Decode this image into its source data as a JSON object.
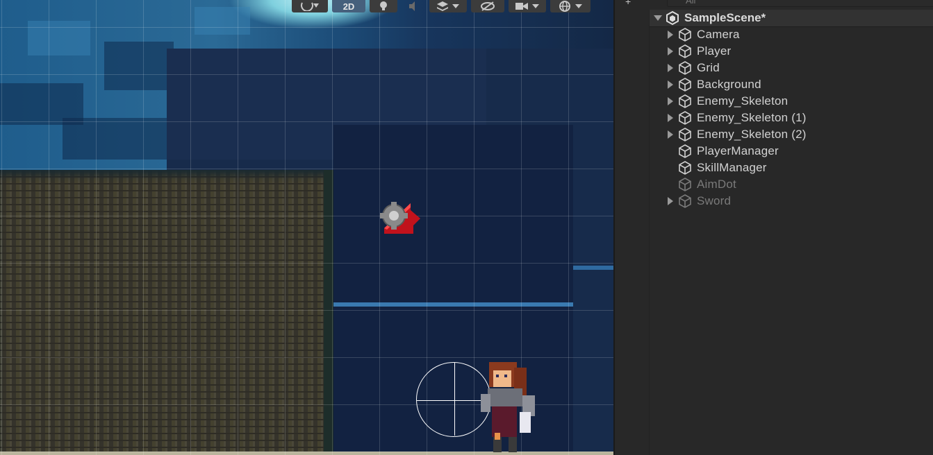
{
  "toolbar": {
    "mode_2d_label": "2D"
  },
  "hierarchy": {
    "search_placeholder": "All",
    "add_label": "+",
    "scene_name": "SampleScene*",
    "items": [
      {
        "name": "Camera",
        "expandable": true,
        "dimmed": false
      },
      {
        "name": "Player",
        "expandable": true,
        "dimmed": false
      },
      {
        "name": "Grid",
        "expandable": true,
        "dimmed": false
      },
      {
        "name": "Background",
        "expandable": true,
        "dimmed": false
      },
      {
        "name": "Enemy_Skeleton",
        "expandable": true,
        "dimmed": false
      },
      {
        "name": "Enemy_Skeleton (1)",
        "expandable": true,
        "dimmed": false
      },
      {
        "name": "Enemy_Skeleton (2)",
        "expandable": true,
        "dimmed": false
      },
      {
        "name": "PlayerManager",
        "expandable": false,
        "dimmed": false
      },
      {
        "name": "SkillManager",
        "expandable": false,
        "dimmed": false
      },
      {
        "name": "AimDot",
        "expandable": false,
        "dimmed": true
      },
      {
        "name": "Sword",
        "expandable": true,
        "dimmed": true
      }
    ]
  },
  "icons": {
    "object": "cube-icon",
    "scene": "unity-scene-icon",
    "camera_gizmo": "camera-gizmo-icon",
    "light": "light-bulb-icon",
    "audio": "audio-mute-icon",
    "effects": "layers-icon",
    "visibility": "hidden-eye-icon",
    "gizmos": "gizmo-globe-icon"
  },
  "colors": {
    "panel_bg": "#282828",
    "active_button": "#46607c",
    "text": "#d2d2d2",
    "dim_text": "#7a7a7a"
  }
}
